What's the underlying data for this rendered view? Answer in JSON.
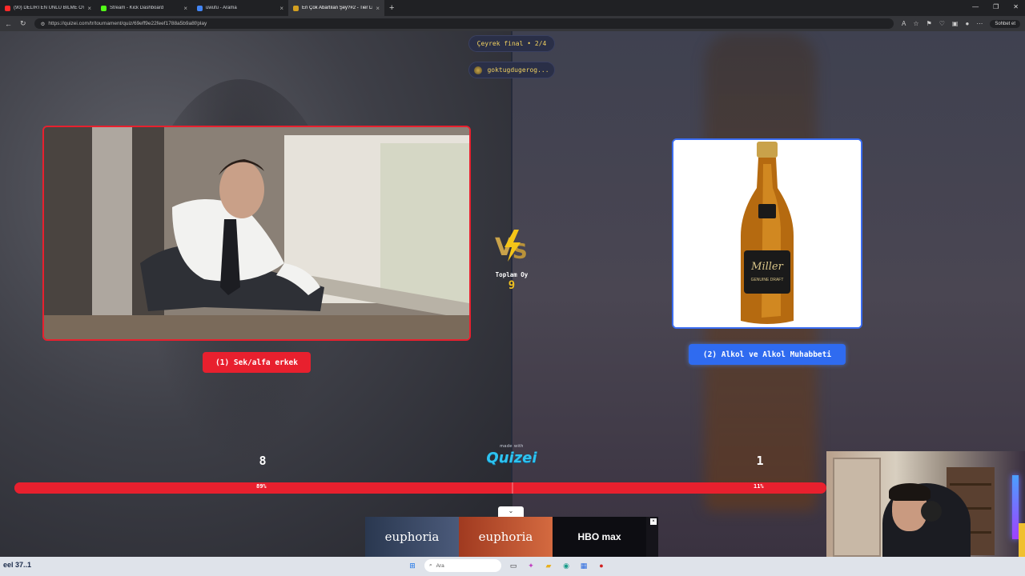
{
  "browser": {
    "tabs": [
      {
        "title": "(90) DELİRTEN ÜNLÜ BİLME OYUN",
        "color": "#ff2a2a"
      },
      {
        "title": "Stream - Kick Dashboard",
        "color": "#53fc18"
      },
      {
        "title": "uwufu - Arama",
        "color": "#4285f4"
      },
      {
        "title": "En Çok Abartılan Şey?#2 - Tier Lis",
        "color": "#d4a020"
      }
    ],
    "url": "https://quizei.com/tr/tournament/quiz/69eff9e22feef1788a5b9a8f/play",
    "chat_button": "Sohbet et"
  },
  "match": {
    "round": "Çeyrek final • 2/4",
    "username": "goktugdugerog...",
    "total_votes_label": "Toplam Oy",
    "total_votes": "9",
    "left": {
      "label": "(1) Sek/alfa erkek",
      "votes": "8",
      "percent_text": "89%",
      "percent": 89,
      "color": "#e8202e"
    },
    "right": {
      "label": "(2) Alkol ve Alkol Muhabbeti",
      "votes": "1",
      "percent_text": "11%",
      "percent": 11,
      "color": "#2f6bf0"
    },
    "made_with": "made with",
    "brand": "Quizei"
  },
  "ad": {
    "panels": [
      "euphoria",
      "euphoria",
      "HBO max"
    ]
  },
  "taskbar": {
    "search": "Ara",
    "left_text": "eel 37..1"
  }
}
